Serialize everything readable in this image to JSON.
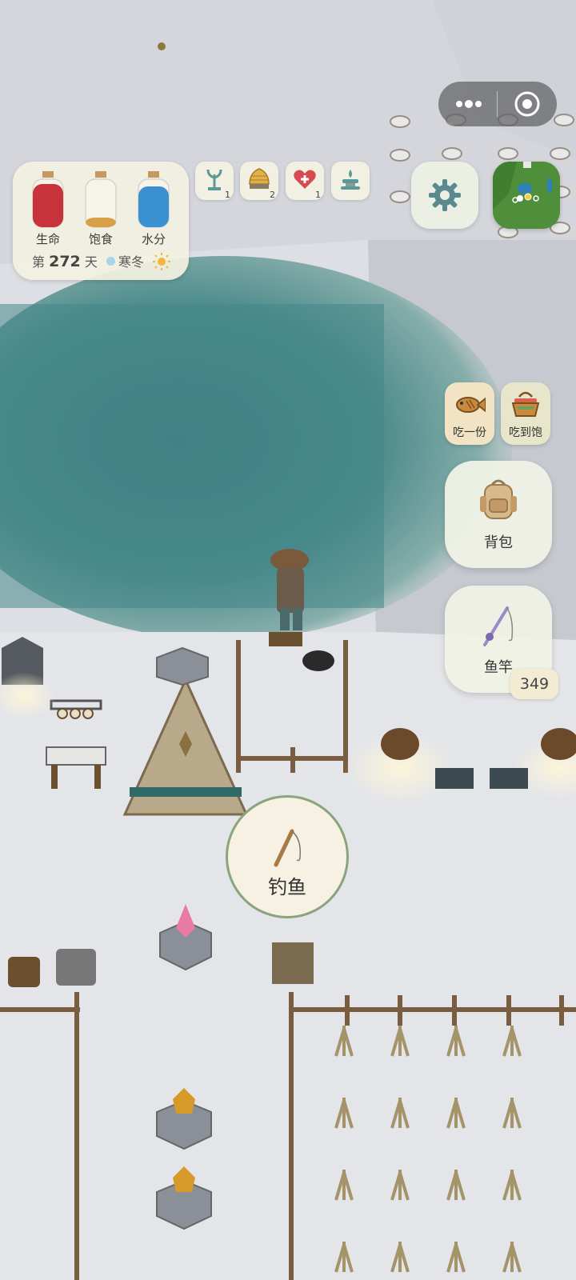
{
  "stats": {
    "health_label": "生命",
    "hunger_label": "饱食",
    "water_label": "水分",
    "health_level": 0.9,
    "hunger_level": 0.2,
    "water_level": 0.85,
    "day_prefix": "第",
    "day_number": "272",
    "day_suffix": "天",
    "season": "寒冬",
    "weather_icon": "sun-icon"
  },
  "buffs": [
    {
      "icon": "seedling-icon",
      "count": "1"
    },
    {
      "icon": "beehive-icon",
      "count": "2"
    },
    {
      "icon": "heart-plus-icon",
      "count": "1"
    },
    {
      "icon": "fountain-icon",
      "count": ""
    }
  ],
  "system": {
    "more_icon": "more-dots-icon",
    "close_icon": "target-circle-icon"
  },
  "settings": {
    "icon": "gear-icon"
  },
  "eat": {
    "one_label": "吃一份",
    "full_label": "吃到饱"
  },
  "backpack": {
    "label": "背包"
  },
  "rod": {
    "label": "鱼竿",
    "count": "349"
  },
  "fish_action": {
    "label": "钓鱼"
  },
  "colors": {
    "panel": "#f3f1e2",
    "health": "#c8323a",
    "hunger": "#d9a04a",
    "water": "#3a90d0",
    "fish_button_border": "#8aa47c",
    "lake": "#3e7a80",
    "snow": "#e2e4e8"
  }
}
